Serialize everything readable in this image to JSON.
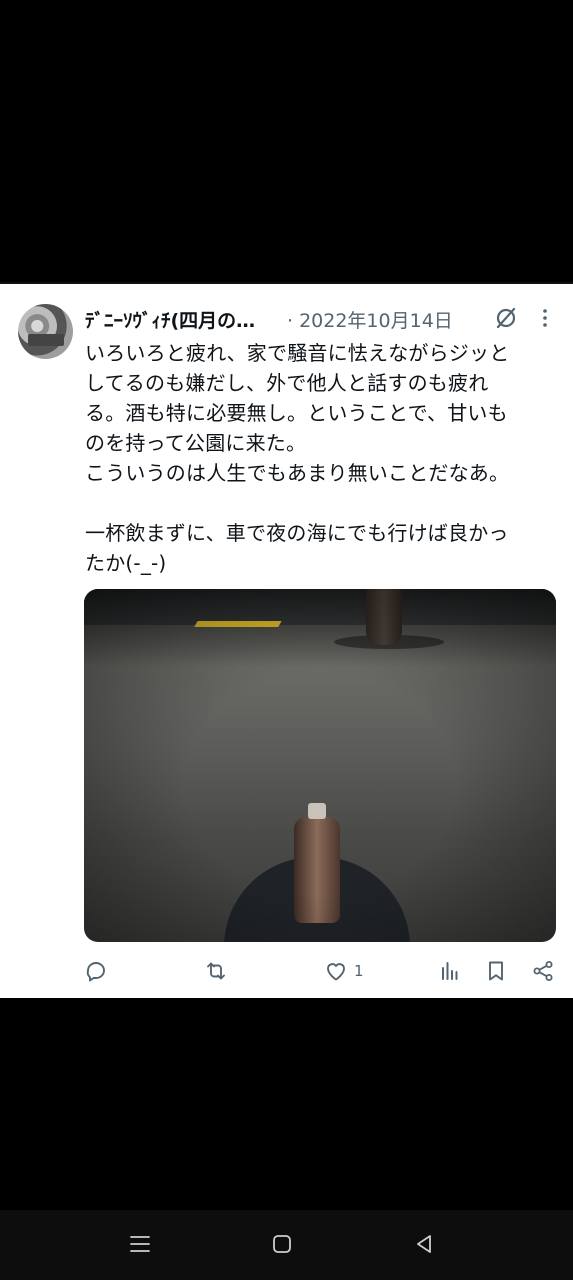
{
  "tweet": {
    "author_name": "ﾃﾞﾆｰｿｳﾞｨﾁ(四月の…",
    "date": "· 2022年10月14日",
    "text": "いろいろと疲れ、家で騒音に怯えながらジッと\nしてるのも嫌だし、外で他人と話すのも疲れ\nる。酒も特に必要無し。ということで、甘いも\nのを持って公園に来た。\nこういうのは人生でもあまり無いことだなあ。\n\n一杯飲まずに、車で夜の海にでも行けば良かっ\nたか(-_-)",
    "like_count": "1"
  },
  "icons": {
    "header": [
      "grok-icon",
      "more-icon"
    ],
    "actions": [
      "reply-icon",
      "retweet-icon",
      "like-icon",
      "views-icon",
      "bookmark-icon",
      "share-icon"
    ],
    "nav": [
      "recents-icon",
      "home-icon",
      "back-icon"
    ]
  },
  "colors": {
    "text": "#0f1419",
    "secondary": "#536471",
    "background": "#ffffff",
    "slide": "#d7b727"
  }
}
